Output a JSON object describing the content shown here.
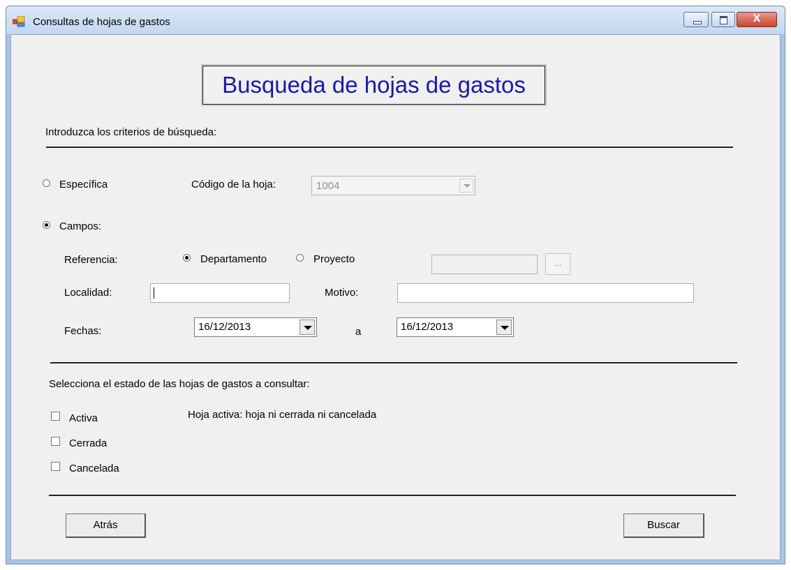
{
  "window": {
    "title": "Consultas de hojas de gastos",
    "close_glyph": "X"
  },
  "heading": "Busqueda de hojas de gastos",
  "criteria_label": "Introduzca los criterios de búsqueda:",
  "mode": {
    "specific_label": "Específica",
    "specific_selected": false,
    "fields_label": "Campos:",
    "fields_selected": true
  },
  "sheet_code": {
    "label": "Código de la hoja:",
    "value": "1004",
    "enabled": false
  },
  "reference": {
    "label": "Referencia:",
    "department_label": "Departamento",
    "department_selected": true,
    "project_label": "Proyecto",
    "project_selected": false,
    "project_value": "",
    "browse_label": "..."
  },
  "locality": {
    "label": "Localidad:",
    "value": ""
  },
  "reason": {
    "label": "Motivo:",
    "value": ""
  },
  "dates": {
    "label": "Fechas:",
    "from": "16/12/2013",
    "separator": "a",
    "to": "16/12/2013"
  },
  "status": {
    "label": "Selecciona el estado de las hojas de gastos a consultar:",
    "options": [
      {
        "label": "Activa",
        "checked": false
      },
      {
        "label": "Cerrada",
        "checked": false
      },
      {
        "label": "Cancelada",
        "checked": false
      }
    ],
    "hint": "Hoja activa: hoja ni cerrada ni cancelada"
  },
  "buttons": {
    "back_label": "Atrás",
    "search_label": "Buscar"
  },
  "colors": {
    "heading_text": "#1a1aa6",
    "window_frame": "#a9c4e4",
    "client_bg": "#f0f0f0"
  }
}
